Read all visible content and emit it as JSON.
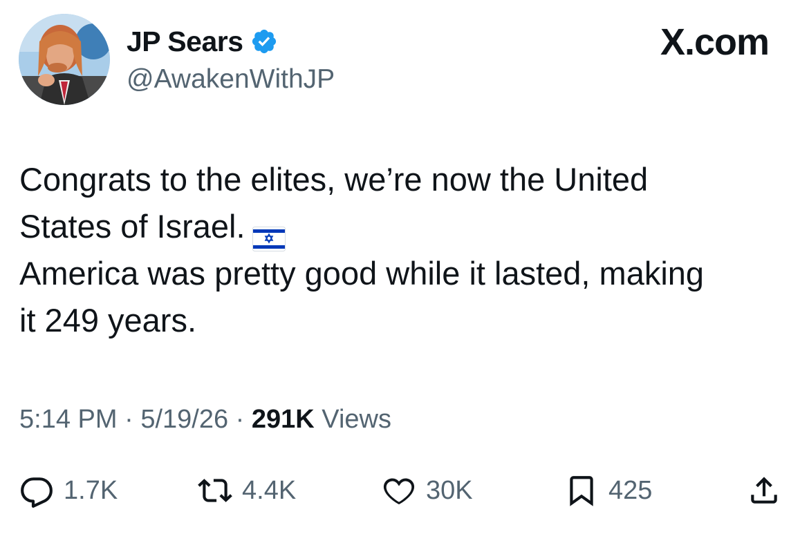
{
  "tweet": {
    "author": {
      "name": "JP Sears",
      "handle": "@AwakenWithJP",
      "verified": true
    },
    "brand": "X.com",
    "text_lines": [
      "Congrats to the elites, we’re now the United",
      "States of Israel.",
      "America was pretty good while it lasted, making",
      "it 249 years."
    ],
    "flag_emoji": "israel-flag-icon",
    "meta": {
      "time": "5:14 PM",
      "separator": "·",
      "date": "5/19/26",
      "views_count": "291K",
      "views_label": "Views"
    },
    "actions": {
      "replies": "1.7K",
      "reposts": "4.4K",
      "likes": "30K",
      "bookmarks": "425"
    }
  },
  "colors": {
    "text": "#0f1419",
    "secondary": "#536471",
    "verified_blue": "#1d9bf0",
    "flag_blue": "#0038b8"
  }
}
